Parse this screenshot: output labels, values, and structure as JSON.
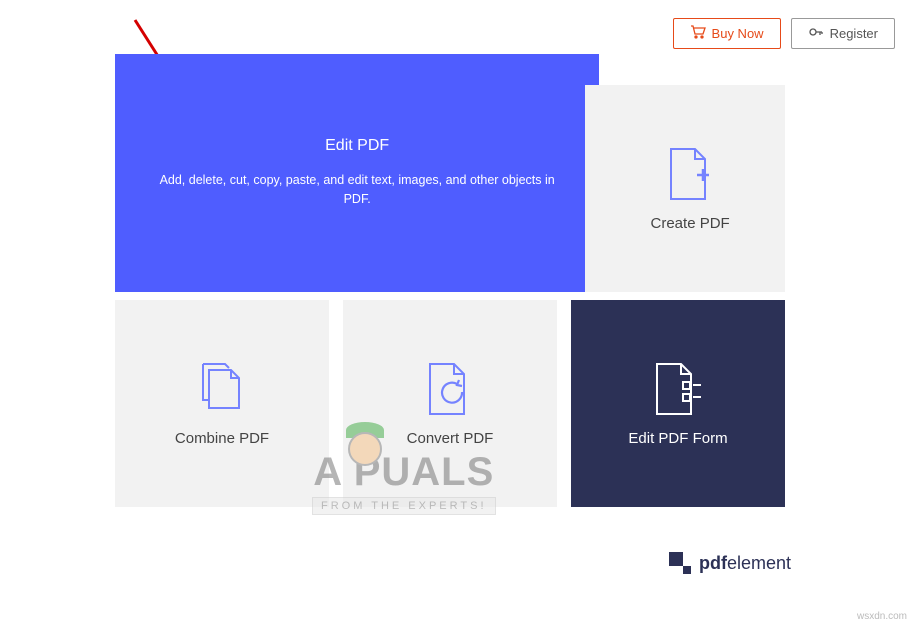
{
  "header": {
    "buy_label": "Buy Now",
    "register_label": "Register"
  },
  "cards": {
    "edit_pdf": {
      "title": "Edit PDF",
      "desc": "Add, delete, cut, copy, paste, and edit text, images, and other objects in PDF."
    },
    "create_pdf": {
      "title": "Create PDF"
    },
    "combine_pdf": {
      "title": "Combine PDF"
    },
    "convert_pdf": {
      "title": "Convert PDF"
    },
    "edit_form": {
      "title": "Edit PDF Form"
    }
  },
  "brand": {
    "name_prefix": "pdf",
    "name_suffix": "element"
  },
  "watermark": {
    "title": "A PUALS",
    "subtitle": "FROM THE EXPERTS!"
  },
  "footer_url": "wsxdn.com"
}
